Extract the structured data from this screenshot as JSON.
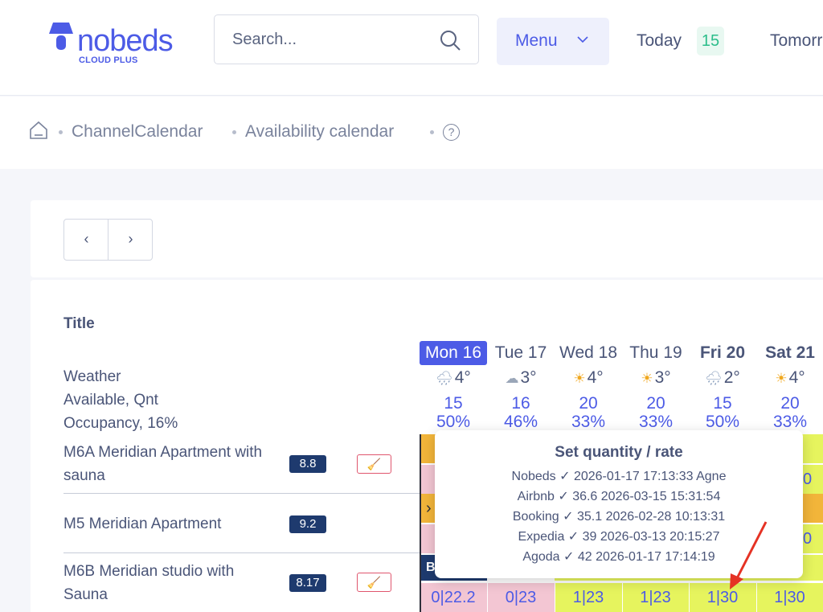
{
  "header": {
    "logo_text": "nobeds",
    "logo_sub": "CLOUD PLUS",
    "search_placeholder": "Search...",
    "menu_label": "Menu",
    "today_label": "Today",
    "today_count": "15",
    "tomorrow_label": "Tomorrow"
  },
  "breadcrumb": {
    "items": [
      "ChannelCalendar",
      "Availability calendar"
    ],
    "help": "?"
  },
  "nav": {
    "prev": "‹",
    "next": "›"
  },
  "calendar": {
    "title_header": "Title",
    "row_labels": [
      "Weather",
      "Available, Qnt",
      "Occupancy, 16%"
    ],
    "days": [
      {
        "label": "Mon 16",
        "active": true,
        "bold": false,
        "weather_icon": "rain-cloud-icon",
        "temp": "4°",
        "available": "15",
        "occupancy": "50%"
      },
      {
        "label": "Tue 17",
        "active": false,
        "bold": false,
        "weather_icon": "cloud-icon",
        "temp": "3°",
        "available": "16",
        "occupancy": "46%"
      },
      {
        "label": "Wed 18",
        "active": false,
        "bold": false,
        "weather_icon": "sun-icon",
        "temp": "4°",
        "available": "20",
        "occupancy": "33%"
      },
      {
        "label": "Thu 19",
        "active": false,
        "bold": false,
        "weather_icon": "sun-icon",
        "temp": "3°",
        "available": "20",
        "occupancy": "33%"
      },
      {
        "label": "Fri 20",
        "active": false,
        "bold": true,
        "weather_icon": "rain-cloud-icon",
        "temp": "2°",
        "available": "15",
        "occupancy": "50%"
      },
      {
        "label": "Sat 21",
        "active": false,
        "bold": true,
        "weather_icon": "sun-icon",
        "temp": "4°",
        "available": "20",
        "occupancy": "33%"
      }
    ],
    "rooms": [
      {
        "name": "M6A Meridian Apartment with sauna",
        "rating": "8.8",
        "clean": true
      },
      {
        "name": "M5 Meridian Apartment",
        "rating": "9.2",
        "clean": false
      },
      {
        "name": "M6B Meridian studio with Sauna",
        "rating": "8.17",
        "clean": true
      }
    ],
    "partial_cells": {
      "row1_right": "0",
      "row2_left": "›",
      "row2_right": "0",
      "row3_left": "B"
    },
    "bottom_cells": [
      "0|22.2",
      "0|23",
      "1|23",
      "1|23",
      "1|30",
      "1|30"
    ],
    "colors": {
      "pink": "#f3c6d3",
      "lime": "#e6f45e",
      "orange": "#f2b53a",
      "accent": "#4c5be6"
    }
  },
  "tooltip": {
    "title": "Set quantity / rate",
    "lines": [
      "Nobeds ✓ 2026-01-17 17:13:33 Agne",
      "Airbnb ✓ 36.6 2026-03-15 15:31:54",
      "Booking ✓ 35.1 2026-02-28 10:13:31",
      "Expedia ✓ 39 2026-03-13 20:15:27",
      "Agoda ✓ 42 2026-01-17 17:14:19"
    ]
  }
}
